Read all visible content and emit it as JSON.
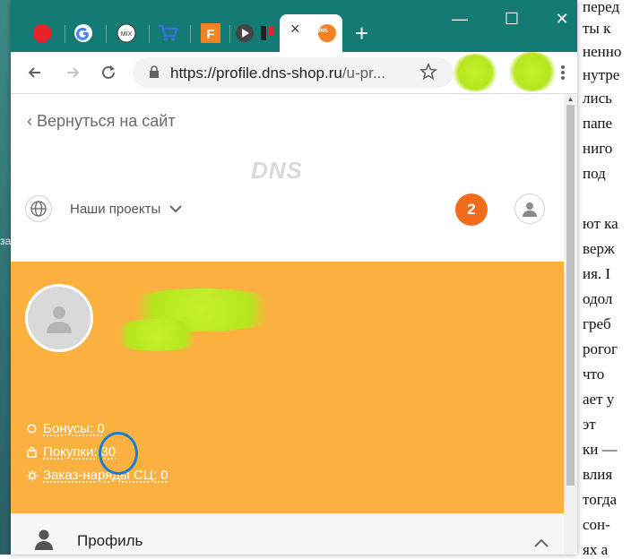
{
  "background_document": {
    "lines": [
      "перед",
      "ты к",
      "ненно",
      "нутре",
      "лись",
      "папе",
      "ниго",
      "под",
      "ют ка",
      "верж",
      "ия. I",
      "одол",
      "греб",
      "рогог",
      "что",
      "ает у",
      "эт",
      "ки —",
      "влия",
      "тогда",
      "сон-",
      "ях а"
    ],
    "left_fragment": "за"
  },
  "browser": {
    "tab_icons": [
      "red-stop-icon",
      "google-icon",
      "mix-icon",
      "cart-icon",
      "f-icon",
      "play-icon",
      "bookmark-icon",
      "dns-icon"
    ],
    "active_tab_close": "×",
    "new_tab": "+",
    "window_controls": {
      "minimize": "—",
      "maximize": "☐",
      "close": "✕"
    },
    "url_host": "https://profile.dns-shop.ru",
    "url_rest": "/u-pr...",
    "new_tab_favicon_text": "DNS"
  },
  "page": {
    "back_link": "‹ Вернуться на сайт",
    "logo": "DNS",
    "projects_label": "Наши проекты",
    "notification_count": "2",
    "stats": {
      "bonuses": "Бонусы: 0",
      "purchases_label": "Покупки:",
      "purchases_value": "30",
      "orders": "Заказ-наряды СЦ: 0"
    },
    "profile_section": "Профиль"
  },
  "colors": {
    "tab_bar": "#137a74",
    "profile_card": "#fbb040",
    "notification": "#f26b1d",
    "highlight": "#1b7fd1",
    "redaction": "#b5e61d"
  }
}
